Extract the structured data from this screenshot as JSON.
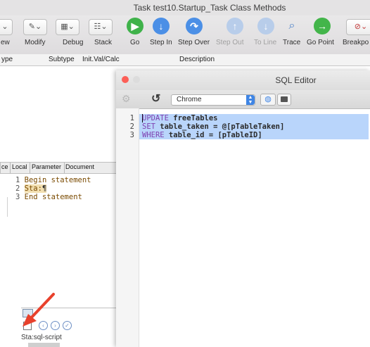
{
  "window": {
    "title": "Task test10.Startup_Task Class Methods"
  },
  "toolbar": {
    "buttons": [
      {
        "label": "ew",
        "icon": "view-icon"
      },
      {
        "label": "Modify",
        "icon": "modify-icon"
      },
      {
        "label": "Debug",
        "icon": "debug-icon"
      },
      {
        "label": "Stack",
        "icon": "stack-icon"
      },
      {
        "label": "Go",
        "icon": "go-icon"
      },
      {
        "label": "Step In",
        "icon": "step-in-icon"
      },
      {
        "label": "Step Over",
        "icon": "step-over-icon"
      },
      {
        "label": "Step Out",
        "icon": "step-out-icon"
      },
      {
        "label": "To Line",
        "icon": "to-line-icon"
      },
      {
        "label": "Trace",
        "icon": "trace-icon"
      },
      {
        "label": "Go Point",
        "icon": "go-point-icon"
      },
      {
        "label": "Breakpo",
        "icon": "breakpoint-icon"
      }
    ]
  },
  "columns": {
    "type": "ype",
    "subtype": "Subtype",
    "init": "Init.Val/Calc",
    "description": "Description"
  },
  "left_panel": {
    "tabs": [
      "ce",
      "Local",
      "Parameter",
      "Document"
    ],
    "code": [
      {
        "num": "1",
        "text": "Begin statement"
      },
      {
        "num": "2",
        "prefix": "Sta:",
        "cursor": "¶"
      },
      {
        "num": "3",
        "text": "End statement"
      }
    ],
    "status": "Sta:sql-script"
  },
  "sql_editor": {
    "title": "SQL Editor",
    "browser": "Chrome",
    "lines": [
      {
        "num": "1",
        "kw": "UPDATE",
        "rest": " freeTables"
      },
      {
        "num": "2",
        "kw": "SET",
        "rest": " table_taken = @[pTableTaken]"
      },
      {
        "num": "3",
        "kw": "WHERE",
        "rest": " table_id = [pTableID]"
      }
    ]
  },
  "colors": {
    "accent": "#3f85e5",
    "selection": "#b9d5fb",
    "keyword": "#7e3fb0",
    "arrow": "#e8412c"
  }
}
